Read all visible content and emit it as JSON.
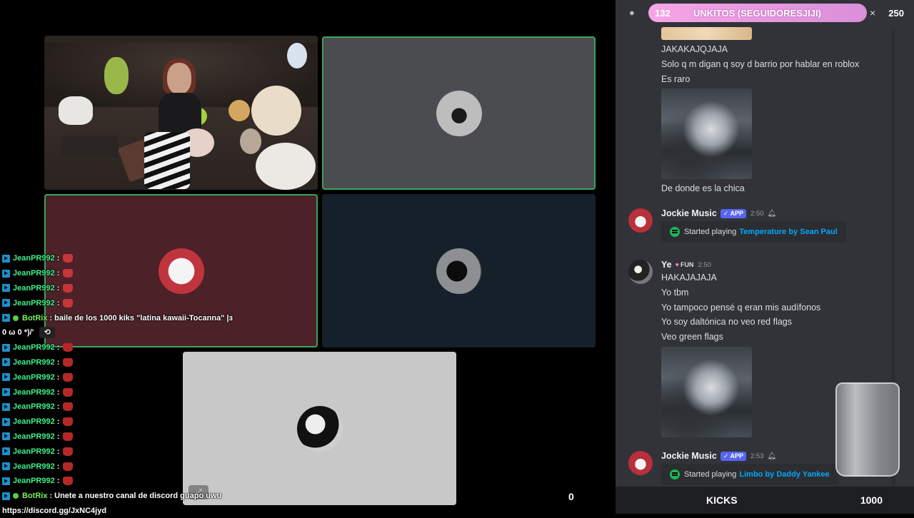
{
  "overlay_chat": {
    "lines": [
      {
        "user": "JeanPR992",
        "type": "emote"
      },
      {
        "user": "JeanPR992",
        "type": "emote"
      },
      {
        "user": "JeanPR992",
        "type": "emote"
      },
      {
        "user": "JeanPR992",
        "type": "emote"
      },
      {
        "user": "BotRix",
        "type": "text",
        "message": "baile de los 1000 kiks \"latina kawaii-Tocanna\" |з",
        "wrap": "0 ω 0 *)/'"
      },
      {
        "user": "JeanPR992",
        "type": "emote"
      },
      {
        "user": "JeanPR992",
        "type": "emote"
      },
      {
        "user": "JeanPR992",
        "type": "emote"
      },
      {
        "user": "JeanPR992",
        "type": "emote"
      },
      {
        "user": "JeanPR992",
        "type": "emote"
      },
      {
        "user": "JeanPR992",
        "type": "emote"
      },
      {
        "user": "JeanPR992",
        "type": "emote"
      },
      {
        "user": "JeanPR992",
        "type": "emote"
      },
      {
        "user": "JeanPR992",
        "type": "emote"
      },
      {
        "user": "JeanPR992",
        "type": "emote"
      },
      {
        "user": "BotRix",
        "type": "text",
        "message": "Unete a nuestro canal de discord guapo uwu",
        "wrap": "https://discord.gg/JxNC4jyd"
      }
    ],
    "separator": ":"
  },
  "zero_counter": "0",
  "alert": {
    "count": "132",
    "title": "UNKITOS (SEGUIDORESJIJI)",
    "close": "×",
    "total": "250"
  },
  "discord": {
    "msgs_top": {
      "l1": "JAKAKAJQJAJA",
      "l2": "Solo q m digan q soy d barrio por hablar en roblox",
      "l3": "Es raro",
      "l4": "De donde es la chica"
    },
    "jockie1": {
      "name": "Jockie Music",
      "tag": "✓ APP",
      "time": "2:50",
      "embed_text": "Started playing",
      "embed_link": "Temperature by Sean Paul"
    },
    "ye": {
      "name": "Ye",
      "tag": "FUN",
      "time": "2:50",
      "lines": [
        "HAKAJAJAJA",
        "Yo tbm",
        "Yo tampoco pensé q eran mis audífonos",
        "Yo soy daltónica no veo red flags",
        "Veo green flags"
      ]
    },
    "jockie2": {
      "name": "Jockie Music",
      "tag": "✓ APP",
      "time": "2:53",
      "embed_text": "Started playing",
      "embed_link": "Limbo by Daddy Yankee"
    }
  },
  "kicks_bar": {
    "label": "KICKS",
    "target": "1000"
  },
  "colors": {
    "speaking": "#3ba55d",
    "discord_bg": "#313338",
    "link": "#00a8fc",
    "alert_pink": "#e89be0"
  }
}
